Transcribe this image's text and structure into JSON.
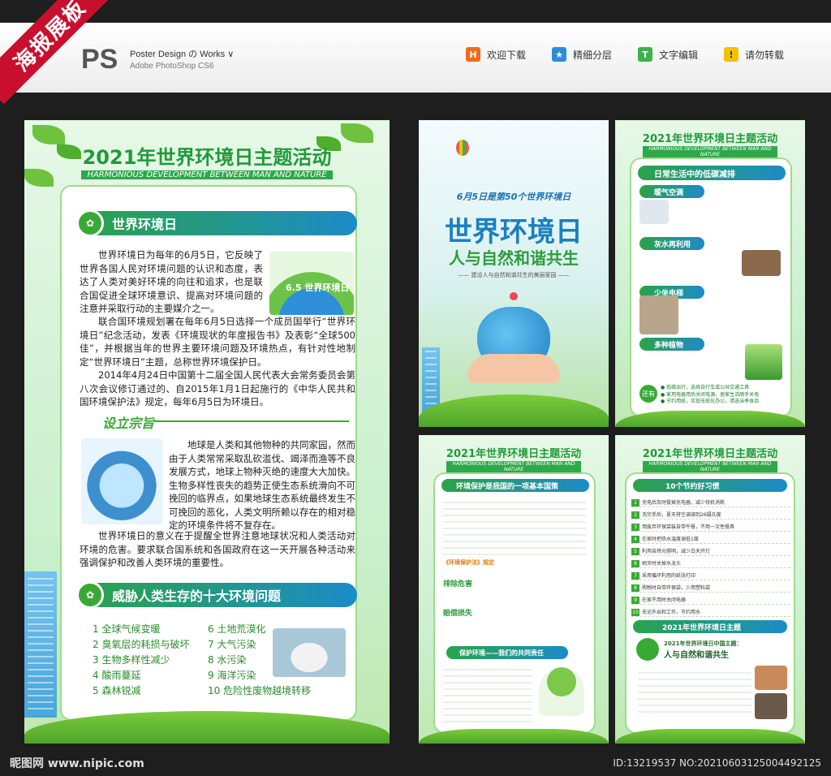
{
  "header": {
    "ribbon": "海报展板",
    "ps_logo": "PS",
    "ps_line1": "Poster Design の Works ∨",
    "ps_line2": "Adobe PhotoShop CS6",
    "badges": [
      {
        "icon": "H",
        "label": "欢迎下载",
        "color": "#f26a1b"
      },
      {
        "icon": "★",
        "label": "精细分层",
        "color": "#2a8fd6"
      },
      {
        "icon": "T",
        "label": "文字编辑",
        "color": "#3bb34a"
      },
      {
        "icon": "!",
        "label": "请勿转载",
        "color": "#f2c200"
      }
    ]
  },
  "main_poster": {
    "title": "2021年世界环境日主题活动",
    "subtitle_en": "HARMONIOUS DEVELOPMENT BETWEEN MAN AND NATURE",
    "section1_title": "世界环境日",
    "img_badge": "6.5 世界环境日",
    "para1": "世界环境日为每年的6月5日，它反映了世界各国人民对环境问题的认识和态度，表达了人类对美好环境的向往和追求，也是联合国促进全球环境意识、提高对环境问题的注意并采取行动的主要媒介之一。",
    "para2": "联合国环境规划署在每年6月5日选择一个成员国举行“世界环境日”纪念活动，发表《环境现状的年度报告书》及表彰“全球500佳”，并根据当年的世界主要环境问题及环境热点，有针对性地制定“世界环境日”主题，总称世界环境保护日。",
    "para3": "2014年4月24日中国第十二届全国人民代表大会常务委员会第八次会议修订通过的、自2015年1月1日起施行的《中华人民共和国环境保护法》规定，每年6月5日为环境日。",
    "section2_title": "设立宗旨",
    "para4": "地球是人类和其他物种的共同家园，然而由于人类常常采取乱砍滥伐、竭泽而渔等不良发展方式，地球上物种灭绝的速度大大加快。生物多样性丧失的趋势正使生态系统滑向不可挽回的临界点，如果地球生态系统最终发生不可挽回的恶化，人类文明所赖以存在的相对稳定的环境条件将不复存在。",
    "para5": "世界环境日的意义在于提醒全世界注意地球状况和人类活动对环境的危害。要求联合国系统和各国政府在这一天开展各种活动来强调保护和改善人类环境的重要性。",
    "section3_title": "威胁人类生存的十大环境问题",
    "problems_left": [
      "1 全球气候变暖",
      "2 臭氧层的耗损与破坏",
      "3 生物多样性减少",
      "4 酸雨蔓延",
      "5 森林锐减"
    ],
    "problems_right": [
      "6 土地荒漠化",
      "7 大气污染",
      "8 水污染",
      "9 海洋污染",
      "10 危险性废物越境转移"
    ]
  },
  "mid_poster": {
    "top_line": "6月5日是第50个世界环境日",
    "title1": "世界环境日",
    "title2": "人与自然和谐共生",
    "slogan": "—— 建设人与自然和谐共生的美丽家园 ——"
  },
  "r1_poster": {
    "title": "2021年世界环境日主题活动",
    "subtitle_en": "HARMONIOUS DEVELOPMENT BETWEEN MAN AND NATURE",
    "section": "日常生活中的低碳减排",
    "items": [
      "暖气空调",
      "灰水再利用",
      "少坐电梯",
      "多种植物"
    ],
    "also": "还有",
    "tips": [
      "● 低碳出行，选择自行车或公共交通工具",
      "● 家用电器用后关闭电源，居家生活随手关电",
      "● 节约用纸，实现无纸化办公，请选当季食品"
    ]
  },
  "m2_poster": {
    "title": "2021年世界环境日主题活动",
    "subtitle_en": "HARMONIOUS DEVELOPMENT BETWEEN MAN AND NATURE",
    "section1": "环境保护是我国的一项基本国策",
    "section2": "保护环境——我们的共同责任",
    "law_label": "《环境保护法》规定",
    "point1": "排除危害",
    "point2": "赔偿损失"
  },
  "r2_poster": {
    "title": "2021年世界环境日主题活动",
    "subtitle_en": "HARMONIOUS DEVELOPMENT BETWEEN MAN AND NATURE",
    "section1": "10个节约好习惯",
    "habits": [
      "充电后及时拔掉充电器，减少待机消耗",
      "洗完手后，夏天将空调调到26摄氏度",
      "用废弃环保袋装自带午餐，不用一次性餐具",
      "在家时把热水温度调低1度",
      "利用自然光照明，减少白天开灯",
      "刷牙时关掉水龙头",
      "采用循环利用的纸张打印",
      "购物时自带环保袋，少用塑料袋",
      "在家不用时关闭电器",
      "无论外出和工作，节约用水"
    ],
    "section2": "2021年世界环境日主题",
    "theme_label": "2021年世界环境日中国主题：",
    "theme": "人与自然和谐共生"
  },
  "footer": {
    "logo": "昵图网 www.nipic.com",
    "id": "ID:13219537 NO:20210603125004492125"
  }
}
